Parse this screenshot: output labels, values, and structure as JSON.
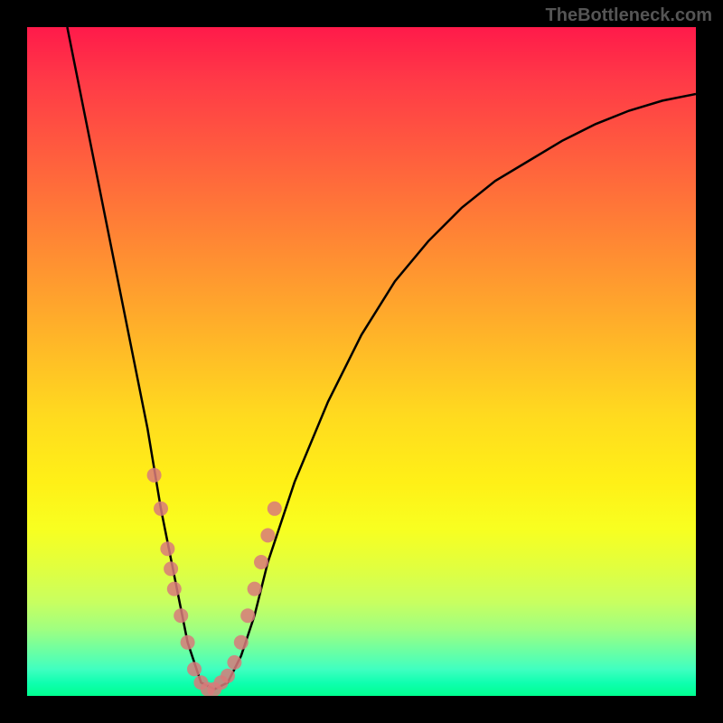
{
  "watermark": "TheBottleneck.com",
  "chart_data": {
    "type": "line",
    "title": "",
    "xlabel": "",
    "ylabel": "",
    "xlim": [
      0,
      100
    ],
    "ylim": [
      0,
      100
    ],
    "background_gradient": {
      "top_color": "#ff1a4a",
      "bottom_color": "#00ff90",
      "description": "vertical rainbow gradient red→orange→yellow→green"
    },
    "curve": {
      "description": "V-shaped bottleneck curve with minimum near x≈27",
      "points": [
        {
          "x": 6,
          "y": 100
        },
        {
          "x": 8,
          "y": 90
        },
        {
          "x": 10,
          "y": 80
        },
        {
          "x": 12,
          "y": 70
        },
        {
          "x": 14,
          "y": 60
        },
        {
          "x": 16,
          "y": 50
        },
        {
          "x": 18,
          "y": 40
        },
        {
          "x": 20,
          "y": 28
        },
        {
          "x": 22,
          "y": 18
        },
        {
          "x": 24,
          "y": 8
        },
        {
          "x": 26,
          "y": 2
        },
        {
          "x": 28,
          "y": 1
        },
        {
          "x": 30,
          "y": 2
        },
        {
          "x": 32,
          "y": 6
        },
        {
          "x": 34,
          "y": 12
        },
        {
          "x": 36,
          "y": 20
        },
        {
          "x": 40,
          "y": 32
        },
        {
          "x": 45,
          "y": 44
        },
        {
          "x": 50,
          "y": 54
        },
        {
          "x": 55,
          "y": 62
        },
        {
          "x": 60,
          "y": 68
        },
        {
          "x": 65,
          "y": 73
        },
        {
          "x": 70,
          "y": 77
        },
        {
          "x": 75,
          "y": 80
        },
        {
          "x": 80,
          "y": 83
        },
        {
          "x": 85,
          "y": 85.5
        },
        {
          "x": 90,
          "y": 87.5
        },
        {
          "x": 95,
          "y": 89
        },
        {
          "x": 100,
          "y": 90
        }
      ]
    },
    "markers": {
      "color": "#d87a7a",
      "description": "scatter points clustered along the V near the bottom",
      "points": [
        {
          "x": 19,
          "y": 33
        },
        {
          "x": 20,
          "y": 28
        },
        {
          "x": 21,
          "y": 22
        },
        {
          "x": 21.5,
          "y": 19
        },
        {
          "x": 22,
          "y": 16
        },
        {
          "x": 23,
          "y": 12
        },
        {
          "x": 24,
          "y": 8
        },
        {
          "x": 25,
          "y": 4
        },
        {
          "x": 26,
          "y": 2
        },
        {
          "x": 27,
          "y": 1
        },
        {
          "x": 28,
          "y": 1
        },
        {
          "x": 29,
          "y": 2
        },
        {
          "x": 30,
          "y": 3
        },
        {
          "x": 31,
          "y": 5
        },
        {
          "x": 32,
          "y": 8
        },
        {
          "x": 33,
          "y": 12
        },
        {
          "x": 34,
          "y": 16
        },
        {
          "x": 35,
          "y": 20
        },
        {
          "x": 36,
          "y": 24
        },
        {
          "x": 37,
          "y": 28
        }
      ]
    }
  }
}
